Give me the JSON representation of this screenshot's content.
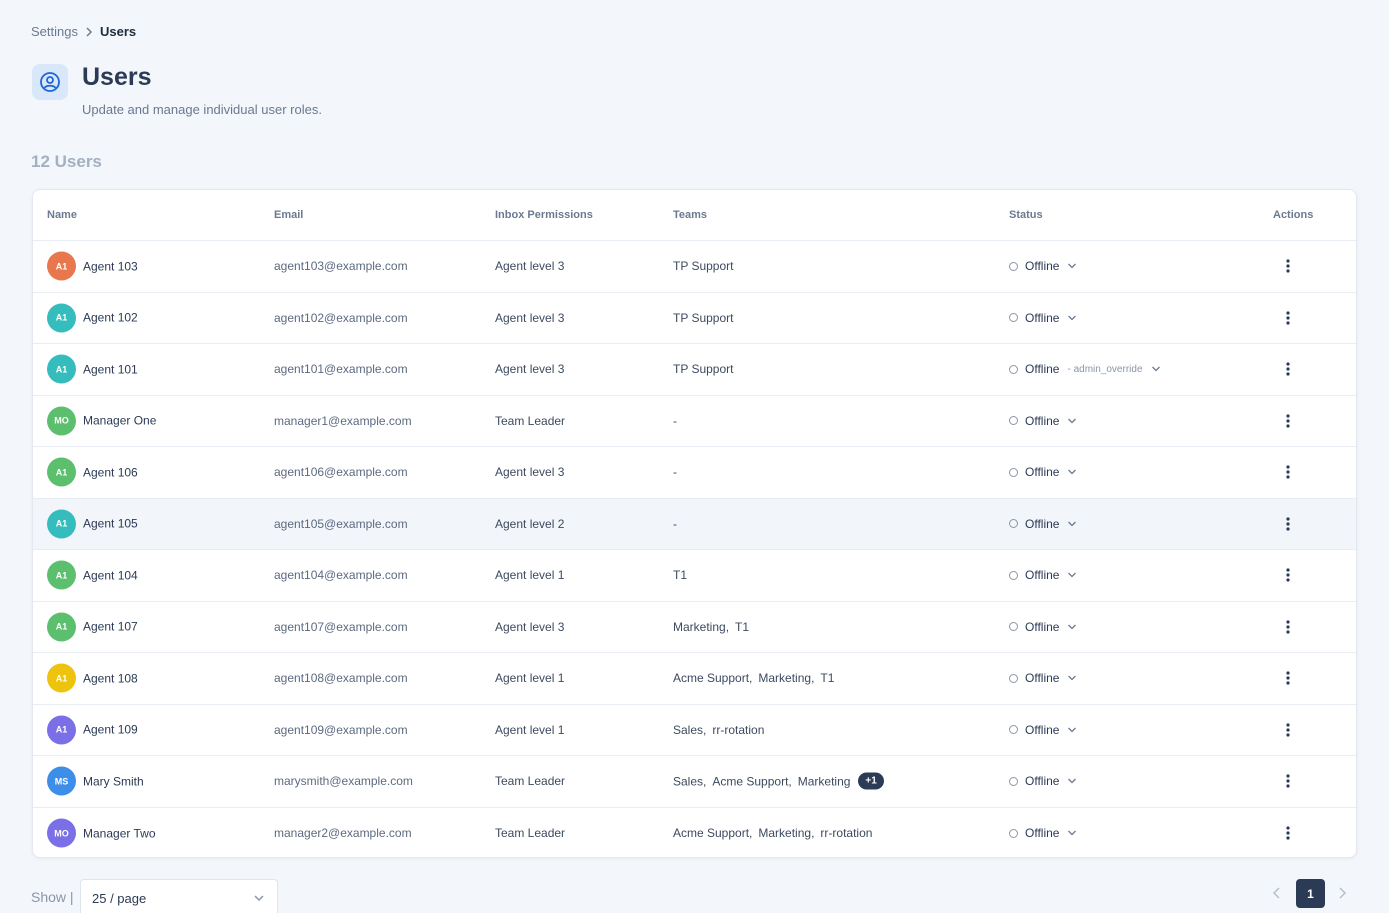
{
  "breadcrumb": {
    "parent": "Settings",
    "current": "Users"
  },
  "header": {
    "title": "Users",
    "subtitle": "Update and manage individual user roles.",
    "icon": "user-circle-icon"
  },
  "users_count": "12 Users",
  "table": {
    "columns": {
      "name": "Name",
      "email": "Email",
      "permissions": "Inbox Permissions",
      "teams": "Teams",
      "status": "Status",
      "actions": "Actions"
    },
    "rows": [
      {
        "initials": "A1",
        "avatar_color": "#e9774e",
        "name": "Agent 103",
        "email": "agent103@example.com",
        "permission": "Agent level 3",
        "teams": [
          "TP Support"
        ],
        "more": "",
        "status": "Offline",
        "override": ""
      },
      {
        "initials": "A1",
        "avatar_color": "#35bcbd",
        "name": "Agent 102",
        "email": "agent102@example.com",
        "permission": "Agent level 3",
        "teams": [
          "TP Support"
        ],
        "more": "",
        "status": "Offline",
        "override": ""
      },
      {
        "initials": "A1",
        "avatar_color": "#35bcbd",
        "name": "Agent 101",
        "email": "agent101@example.com",
        "permission": "Agent level 3",
        "teams": [
          "TP Support"
        ],
        "more": "",
        "status": "Offline",
        "override": "- admin_override"
      },
      {
        "initials": "MO",
        "avatar_color": "#5bbf6e",
        "name": "Manager One",
        "email": "manager1@example.com",
        "permission": "Team Leader",
        "teams": [
          "-"
        ],
        "more": "",
        "status": "Offline",
        "override": ""
      },
      {
        "initials": "A1",
        "avatar_color": "#5bbf6e",
        "name": "Agent 106",
        "email": "agent106@example.com",
        "permission": "Agent level 3",
        "teams": [
          "-"
        ],
        "more": "",
        "status": "Offline",
        "override": ""
      },
      {
        "initials": "A1",
        "avatar_color": "#35bcbd",
        "name": "Agent 105",
        "email": "agent105@example.com",
        "permission": "Agent level 2",
        "teams": [
          "-"
        ],
        "more": "",
        "status": "Offline",
        "override": ""
      },
      {
        "initials": "A1",
        "avatar_color": "#5bbf6e",
        "name": "Agent 104",
        "email": "agent104@example.com",
        "permission": "Agent level 1",
        "teams": [
          "T1"
        ],
        "more": "",
        "status": "Offline",
        "override": ""
      },
      {
        "initials": "A1",
        "avatar_color": "#5bbf6e",
        "name": "Agent 107",
        "email": "agent107@example.com",
        "permission": "Agent level 3",
        "teams": [
          "Marketing,",
          "T1"
        ],
        "more": "",
        "status": "Offline",
        "override": ""
      },
      {
        "initials": "A1",
        "avatar_color": "#eec30e",
        "name": "Agent 108",
        "email": "agent108@example.com",
        "permission": "Agent level 1",
        "teams": [
          "Acme Support,",
          "Marketing,",
          "T1"
        ],
        "more": "",
        "status": "Offline",
        "override": ""
      },
      {
        "initials": "A1",
        "avatar_color": "#7a6fe6",
        "name": "Agent 109",
        "email": "agent109@example.com",
        "permission": "Agent level 1",
        "teams": [
          "Sales,",
          "rr-rotation"
        ],
        "more": "",
        "status": "Offline",
        "override": ""
      },
      {
        "initials": "MS",
        "avatar_color": "#3d8ee8",
        "name": "Mary Smith",
        "email": "marysmith@example.com",
        "permission": "Team Leader",
        "teams": [
          "Sales,",
          "Acme Support,",
          "Marketing"
        ],
        "more": "+1",
        "status": "Offline",
        "override": ""
      },
      {
        "initials": "MO",
        "avatar_color": "#7a6fe6",
        "name": "Manager Two",
        "email": "manager2@example.com",
        "permission": "Team Leader",
        "teams": [
          "Acme Support,",
          "Marketing,",
          "rr-rotation"
        ],
        "more": "",
        "status": "Offline",
        "override": ""
      }
    ]
  },
  "footer": {
    "show_label": "Show |",
    "page_size": "25 / page",
    "current_page": "1"
  },
  "colors": {
    "accent": "#2b3a55",
    "background": "#f3f6fa"
  }
}
